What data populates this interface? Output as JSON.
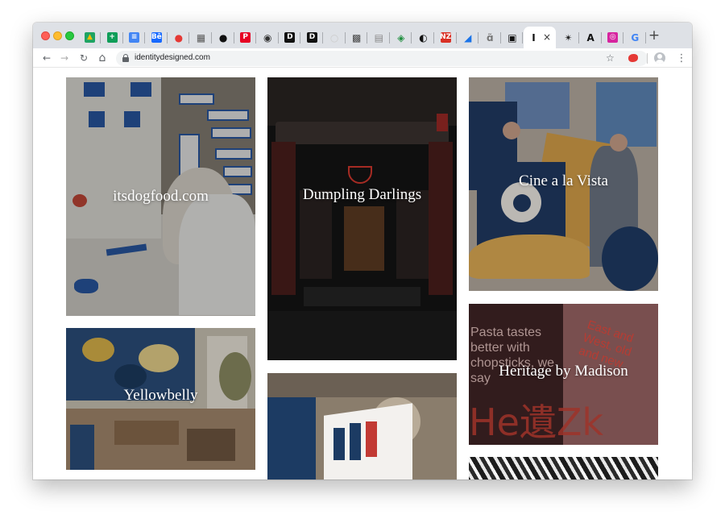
{
  "browser": {
    "url": "identitydesigned.com",
    "tabs": [
      {
        "icon": "google-drive-icon",
        "glyph": "▲",
        "bg": "#1fa463",
        "fg": "#fbbc04"
      },
      {
        "icon": "google-sheets-icon",
        "glyph": "+",
        "bg": "#0f9d58",
        "fg": "#ffffff"
      },
      {
        "icon": "google-docs-icon",
        "glyph": "≡",
        "bg": "#4285f4",
        "fg": "#ffffff"
      },
      {
        "icon": "behance-icon",
        "glyph": "Bē",
        "bg": "#1769ff",
        "fg": "#ffffff"
      },
      {
        "icon": "red-circle-icon",
        "glyph": "●",
        "bg": "transparent",
        "fg": "#e53935"
      },
      {
        "icon": "pixel-grid-icon",
        "glyph": "▦",
        "bg": "transparent",
        "fg": "#5a5a5a"
      },
      {
        "icon": "black-circle-logo-icon",
        "glyph": "●",
        "bg": "transparent",
        "fg": "#111111"
      },
      {
        "icon": "pinterest-icon",
        "glyph": "P",
        "bg": "#e60023",
        "fg": "#ffffff"
      },
      {
        "icon": "badge-circle-icon",
        "glyph": "◉",
        "bg": "transparent",
        "fg": "#333333"
      },
      {
        "icon": "letter-d-square-icon",
        "glyph": "D",
        "bg": "#111111",
        "fg": "#ffffff"
      },
      {
        "icon": "letter-d-circle-icon",
        "glyph": "D",
        "bg": "#111111",
        "fg": "#ffffff"
      },
      {
        "icon": "blank-page-icon",
        "glyph": "○",
        "bg": "transparent",
        "fg": "#cccccc"
      },
      {
        "icon": "grid-pattern-icon",
        "glyph": "▩",
        "bg": "transparent",
        "fg": "#444444"
      },
      {
        "icon": "gray-grid-icon",
        "glyph": "▤",
        "bg": "transparent",
        "fg": "#888888"
      },
      {
        "icon": "green-diamond-icon",
        "glyph": "◈",
        "bg": "transparent",
        "fg": "#1e8e3e"
      },
      {
        "icon": "spiral-icon",
        "glyph": "◐",
        "bg": "transparent",
        "fg": "#111111"
      },
      {
        "icon": "red-label-icon",
        "glyph": "NZ",
        "bg": "#d93025",
        "fg": "#ffffff"
      },
      {
        "icon": "blue-triangle-icon",
        "glyph": "◢",
        "bg": "transparent",
        "fg": "#1a73e8"
      },
      {
        "icon": "bike-icon",
        "glyph": "ɑ̃",
        "bg": "transparent",
        "fg": "#777777"
      },
      {
        "icon": "square-frame-icon",
        "glyph": "▣",
        "bg": "transparent",
        "fg": "#111111"
      }
    ],
    "active_tab": {
      "icon": "identity-designed-icon",
      "glyph": "I",
      "bg": "transparent",
      "fg": "#111111"
    },
    "after_tabs": [
      {
        "icon": "sketch-figure-icon",
        "glyph": "✴",
        "bg": "transparent",
        "fg": "#222222"
      },
      {
        "icon": "a-logo-icon",
        "glyph": "A",
        "bg": "transparent",
        "fg": "#111111"
      },
      {
        "icon": "instagram-icon",
        "glyph": "◎",
        "bg": "#d6249f",
        "fg": "#ffffff"
      },
      {
        "icon": "google-icon",
        "glyph": "G",
        "bg": "transparent",
        "fg": "#4285f4"
      }
    ],
    "new_tab_label": "+",
    "close_tab_glyph": "×",
    "back_glyph": "←",
    "forward_glyph": "→",
    "reload_glyph": "↻",
    "home_glyph": "⌂",
    "star_glyph": "☆",
    "menu_glyph": "⋮"
  },
  "projects": [
    {
      "title": "itsdogfood.com"
    },
    {
      "title": "Dumpling Darlings"
    },
    {
      "title": "Cine a la Vista"
    },
    {
      "title": "Yellowbelly"
    },
    {
      "title": ""
    },
    {
      "title": "Heritage by Madison"
    },
    {
      "title": ""
    }
  ],
  "heritage_art": {
    "left_text": "Pasta tastes better with chopsticks, we say",
    "right_text": "East and West, old and new",
    "big_letters": "He遺Zk"
  },
  "colors": {
    "tabstrip": "#dee1e6",
    "overlay": "rgba(0,0,0,0.35)",
    "heritage_left": "#3a2022",
    "heritage_right": "#8a5a5a",
    "heritage_red": "#c0392b"
  }
}
